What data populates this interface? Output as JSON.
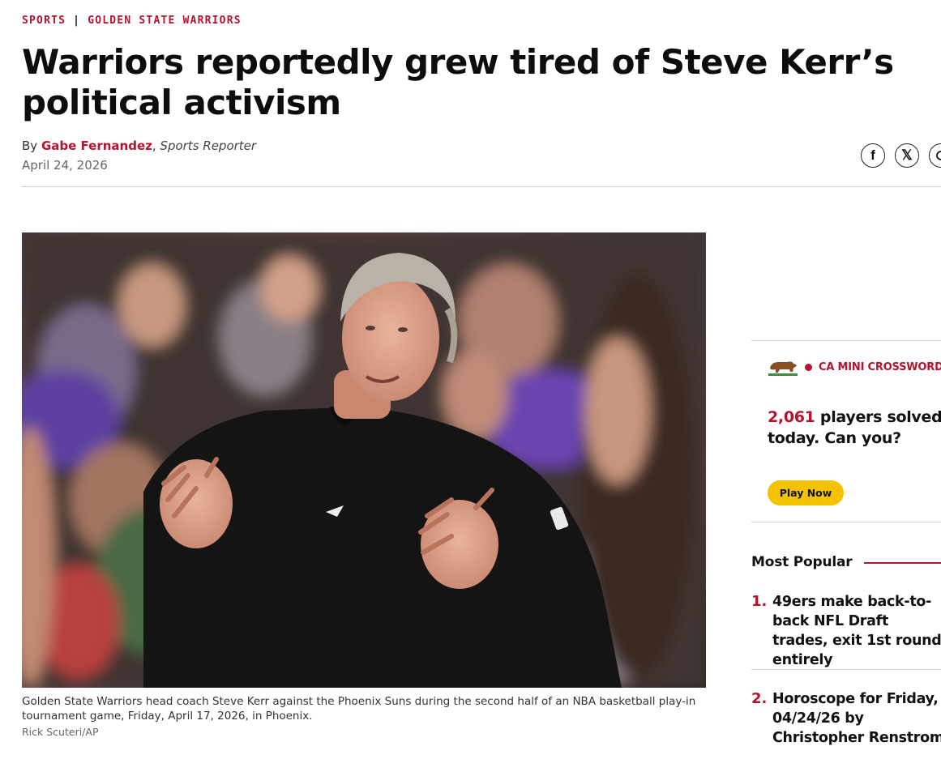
{
  "breadcrumb": {
    "section": "SPORTS",
    "separator": "|",
    "subsection": "GOLDEN STATE WARRIORS"
  },
  "article": {
    "headline": "Warriors reportedly grew tired of Steve Kerr’s political activism",
    "byline_prefix": "By",
    "author": "Gabe Fernandez",
    "author_separator": ",",
    "author_role": "Sports Reporter",
    "date": "April 24, 2026",
    "caption": "Golden State Warriors head coach Steve Kerr against the Phoenix Suns during the second half of an NBA basketball play-in tournament game, Friday, April 17, 2026, in Phoenix.",
    "credit": "Rick Scuteri/AP"
  },
  "share": {
    "icons": [
      "facebook-icon",
      "x-icon",
      "more-share-icon"
    ],
    "facebook_glyph": "f",
    "x_glyph": "𝕏"
  },
  "crossword": {
    "label": "CA MINI CROSSWORD",
    "count": "2,061",
    "text": " players solved today. Can you?",
    "button": "Play Now",
    "icon": "california-bear-icon"
  },
  "most_popular": {
    "title": "Most Popular",
    "items": [
      {
        "num": "1.",
        "title": "49ers make back-to-back NFL Draft trades, exit 1st round entirely"
      },
      {
        "num": "2.",
        "title": "Horoscope for Friday, 04/24/26 by Christopher Renstrom"
      }
    ]
  },
  "colors": {
    "accent": "#b4132e",
    "button": "#f5c200"
  }
}
